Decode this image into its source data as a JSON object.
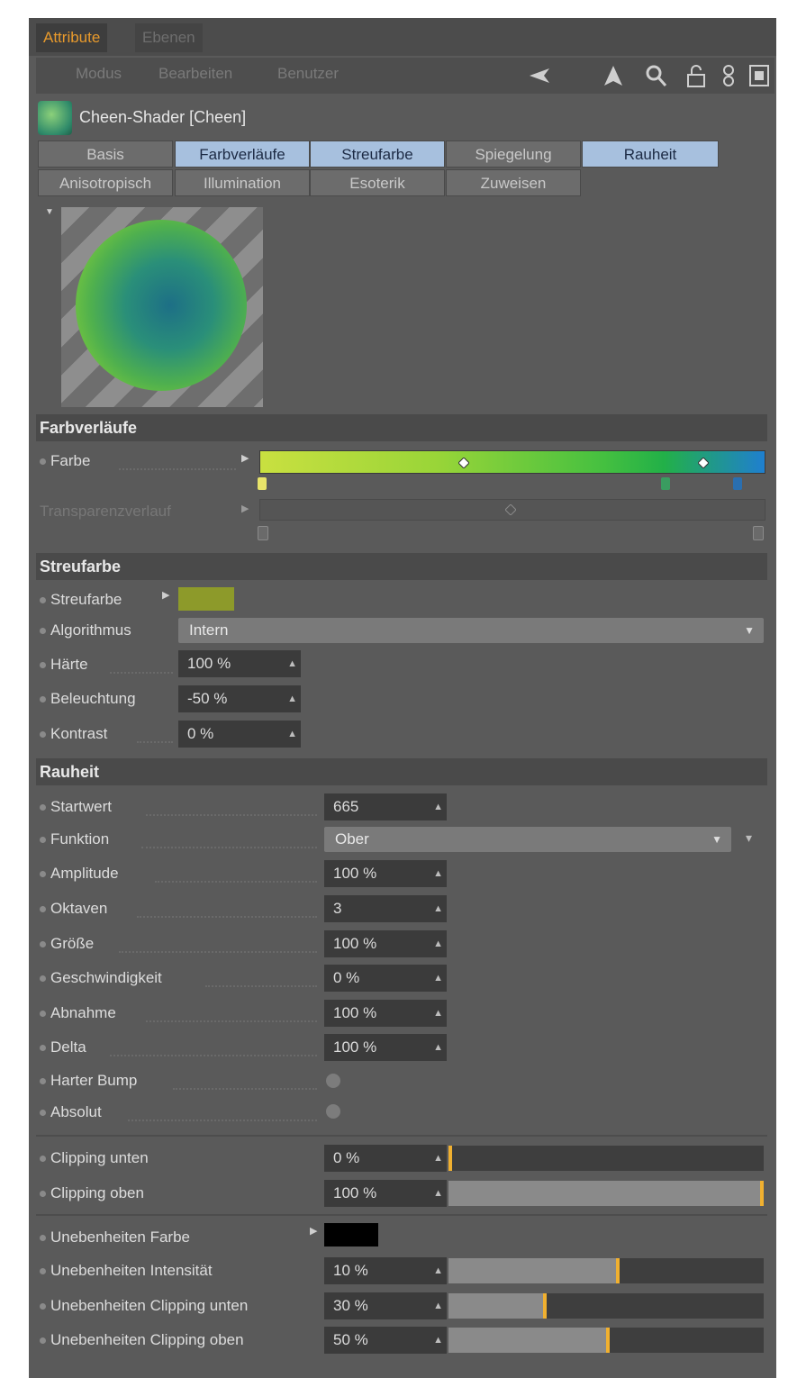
{
  "topTabs": {
    "attribute": "Attribute",
    "ebenen": "Ebenen"
  },
  "menu": {
    "modus": "Modus",
    "bearbeiten": "Bearbeiten",
    "benutzer": "Benutzer"
  },
  "object": {
    "title": "Cheen-Shader [Cheen]"
  },
  "tabs": [
    "Basis",
    "Farbverläufe",
    "Streufarbe",
    "Spiegelung",
    "Rauheit",
    "Anisotropisch",
    "Illumination",
    "Esoterik",
    "Zuweisen"
  ],
  "activeTabs": [
    "Farbverläufe",
    "Streufarbe",
    "Rauheit"
  ],
  "sections": {
    "farbverlaeufe": {
      "title": "Farbverläufe",
      "farbe_label": "Farbe",
      "transparenz_label": "Transparenzverlauf"
    },
    "streufarbe": {
      "title": "Streufarbe",
      "streufarbe_label": "Streufarbe",
      "streufarbe_color": "#8d9a2a",
      "algorithmus_label": "Algorithmus",
      "algorithmus_value": "Intern",
      "haerte_label": "Härte",
      "haerte_value": "100 %",
      "beleuchtung_label": "Beleuchtung",
      "beleuchtung_value": "-50 %",
      "kontrast_label": "Kontrast",
      "kontrast_value": "0 %"
    },
    "rauheit": {
      "title": "Rauheit",
      "startwert_label": "Startwert",
      "startwert_value": "665",
      "funktion_label": "Funktion",
      "funktion_value": "Ober",
      "amplitude_label": "Amplitude",
      "amplitude_value": "100 %",
      "oktaven_label": "Oktaven",
      "oktaven_value": "3",
      "groesse_label": "Größe",
      "groesse_value": "100 %",
      "geschwindigkeit_label": "Geschwindigkeit",
      "geschwindigkeit_value": "0 %",
      "abnahme_label": "Abnahme",
      "abnahme_value": "100 %",
      "delta_label": "Delta",
      "delta_value": "100 %",
      "harterbump_label": "Harter Bump",
      "absolut_label": "Absolut",
      "clipping_unten_label": "Clipping unten",
      "clipping_unten_value": "0 %",
      "clipping_unten_level": 0.0,
      "clipping_oben_label": "Clipping oben",
      "clipping_oben_value": "100 %",
      "clipping_oben_level": 1.0,
      "uneb_farbe_label": "Unebenheiten Farbe",
      "uneb_farbe_color": "#000000",
      "uneb_int_label": "Unebenheiten Intensität",
      "uneb_int_value": "10 %",
      "uneb_int_level": 0.53,
      "uneb_cu_label": "Unebenheiten Clipping unten",
      "uneb_cu_value": "30 %",
      "uneb_cu_level": 0.3,
      "uneb_co_label": "Unebenheiten Clipping oben",
      "uneb_co_value": "50 %",
      "uneb_co_level": 0.5
    }
  },
  "colors": {
    "accent_tab": "#e89a2c",
    "active_tab_bg": "#a7c0de",
    "gradient_start": "#c9e040",
    "gradient_end": "#1f7fd0",
    "slider_handle": "#f0b030"
  }
}
